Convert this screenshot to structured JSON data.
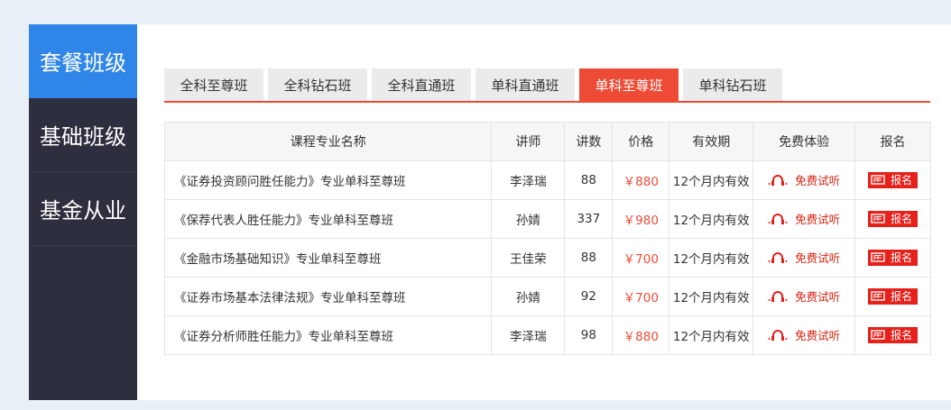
{
  "sidebar": {
    "items": [
      {
        "label": "套餐班级",
        "active": true
      },
      {
        "label": "基础班级",
        "active": false
      },
      {
        "label": "基金从业",
        "active": false
      }
    ]
  },
  "tabs": [
    {
      "label": "全科至尊班",
      "active": false
    },
    {
      "label": "全科钻石班",
      "active": false
    },
    {
      "label": "全科直通班",
      "active": false
    },
    {
      "label": "单科直通班",
      "active": false
    },
    {
      "label": "单科至尊班",
      "active": true
    },
    {
      "label": "单科钻石班",
      "active": false
    }
  ],
  "table": {
    "headers": [
      "课程专业名称",
      "讲师",
      "讲数",
      "价格",
      "有效期",
      "免费体验",
      "报名"
    ],
    "rows": [
      {
        "name": "《证券投资顾问胜任能力》专业单科至尊班",
        "teacher": "李泽瑞",
        "lectures": "88",
        "price": "￥880",
        "validity": "12个月内有效",
        "trial": "免费试听",
        "signup": "报名"
      },
      {
        "name": "《保荐代表人胜任能力》专业单科至尊班",
        "teacher": "孙婧",
        "lectures": "337",
        "price": "￥980",
        "validity": "12个月内有效",
        "trial": "免费试听",
        "signup": "报名"
      },
      {
        "name": "《金融市场基础知识》专业单科至尊班",
        "teacher": "王佳荣",
        "lectures": "88",
        "price": "￥700",
        "validity": "12个月内有效",
        "trial": "免费试听",
        "signup": "报名"
      },
      {
        "name": "《证券市场基本法律法规》专业单科至尊班",
        "teacher": "孙婧",
        "lectures": "92",
        "price": "￥700",
        "validity": "12个月内有效",
        "trial": "免费试听",
        "signup": "报名"
      },
      {
        "name": "《证券分析师胜任能力》专业单科至尊班",
        "teacher": "李泽瑞",
        "lectures": "98",
        "price": "￥880",
        "validity": "12个月内有效",
        "trial": "免费试听",
        "signup": "报名"
      }
    ]
  },
  "colors": {
    "accent": "#ee4b36",
    "sidebar_bg": "#2d2f3e",
    "sidebar_active": "#2f86e8"
  },
  "icons": {
    "trial": "headphones-icon",
    "signup": "cart-icon"
  }
}
